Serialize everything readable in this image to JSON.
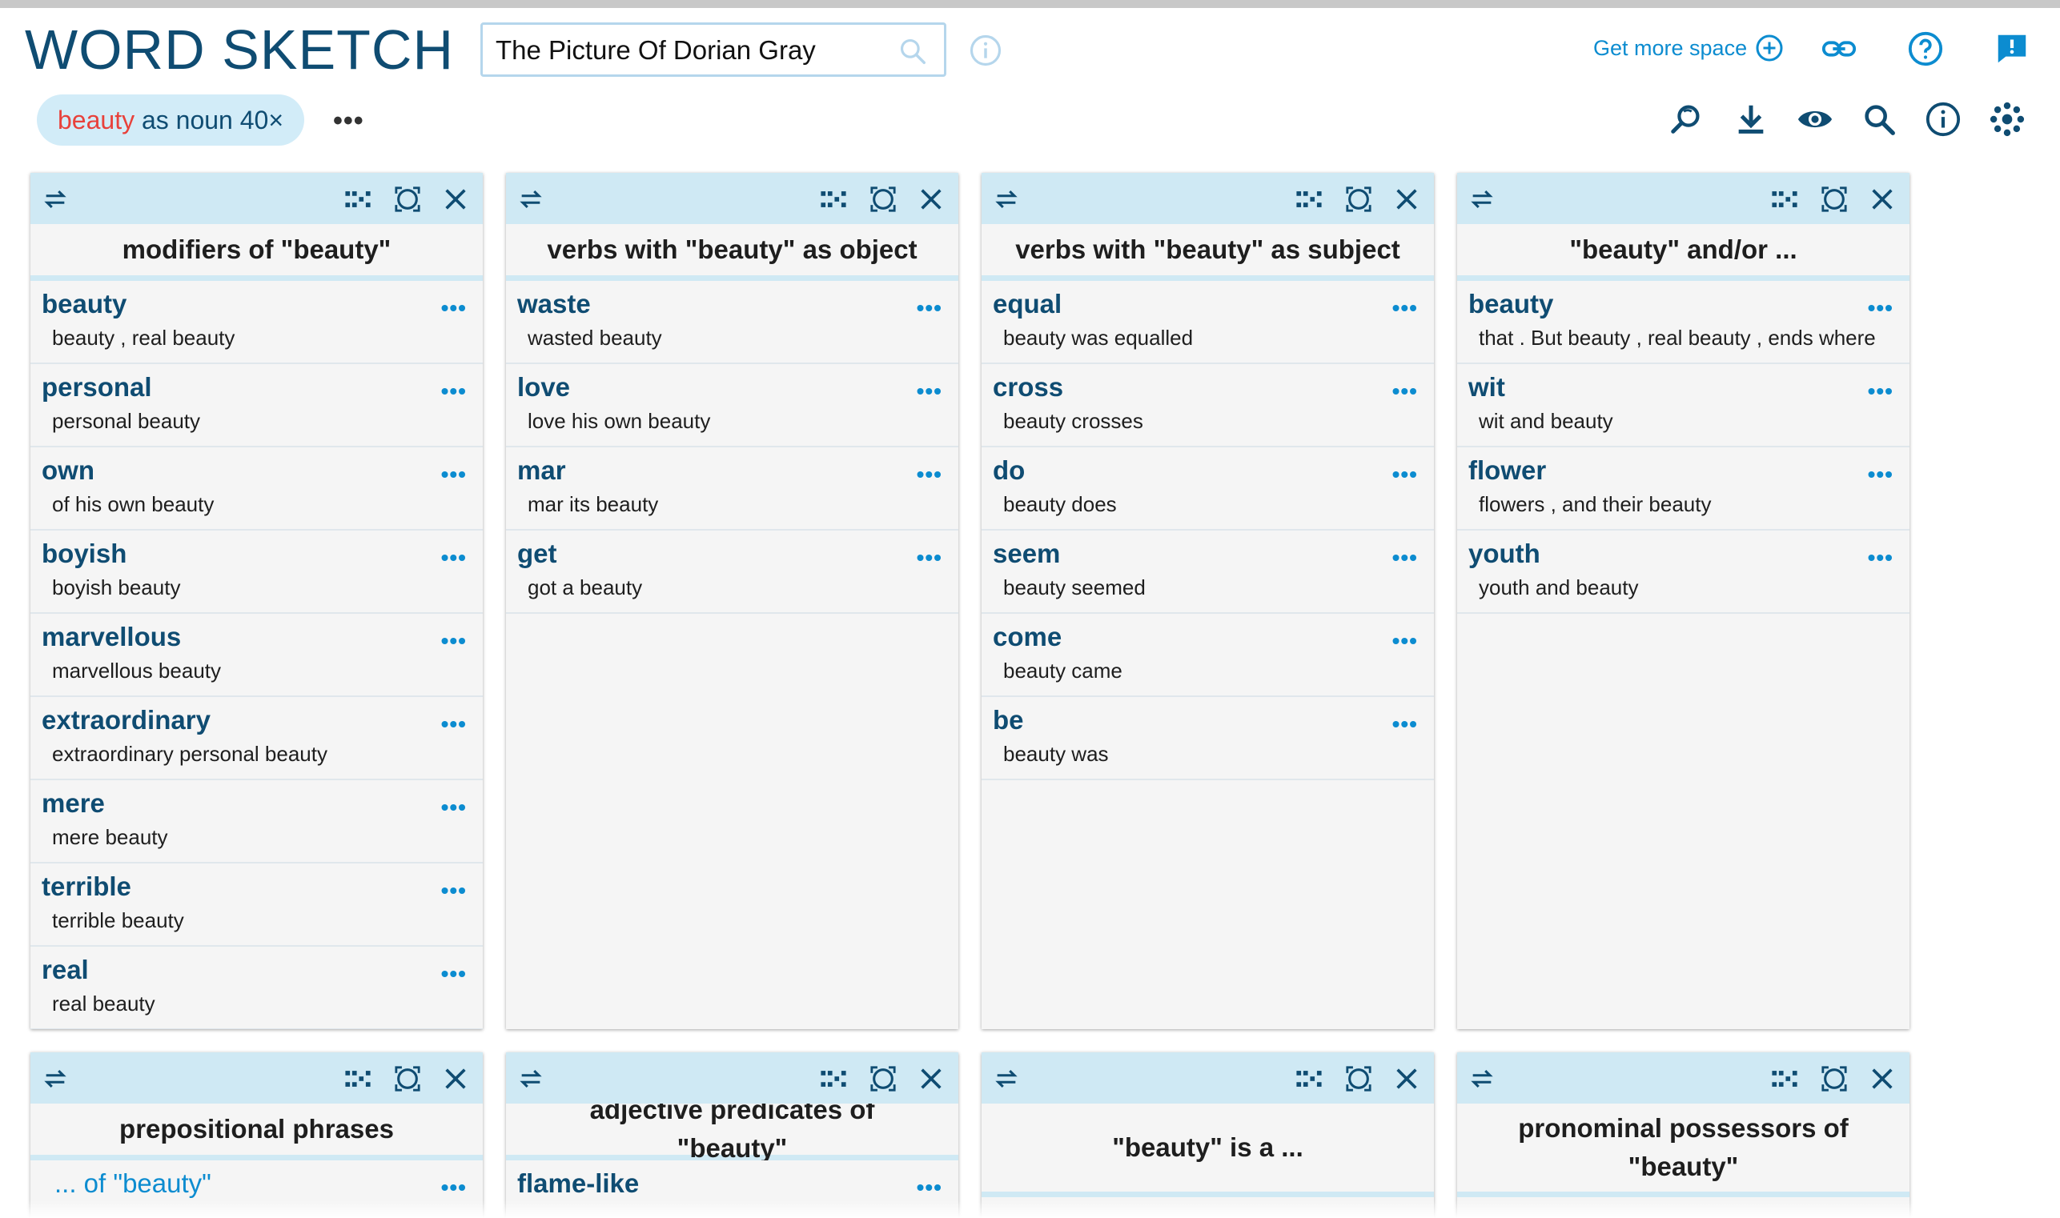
{
  "app": {
    "title": "WORD SKETCH",
    "search_value": "The Picture Of Dorian Gray",
    "get_more_space": "Get more space"
  },
  "query": {
    "word": "beauty",
    "rest": " as noun 40×",
    "more": "•••"
  },
  "colors": {
    "brand": "#0f4c72",
    "accent": "#0c8cd0",
    "highlight": "#e8413b",
    "panel_bar": "#cfe9f4"
  },
  "icons": {
    "top": [
      "info-icon",
      "link-icon",
      "help-icon",
      "feedback-icon"
    ],
    "toolbar": [
      "zoom-search-icon",
      "download-icon",
      "view-icon",
      "search-icon",
      "info-icon",
      "settings-icon"
    ]
  },
  "panels": [
    {
      "title": "modifiers of \"beauty\"",
      "rows": [
        {
          "head": "beauty",
          "ex": "beauty , real beauty"
        },
        {
          "head": "personal",
          "ex": "personal beauty"
        },
        {
          "head": "own",
          "ex": "of his own beauty"
        },
        {
          "head": "boyish",
          "ex": "boyish beauty"
        },
        {
          "head": "marvellous",
          "ex": "marvellous beauty"
        },
        {
          "head": "extraordinary",
          "ex": "extraordinary personal beauty"
        },
        {
          "head": "mere",
          "ex": "mere beauty"
        },
        {
          "head": "terrible",
          "ex": "terrible beauty"
        },
        {
          "head": "real",
          "ex": "real beauty"
        }
      ]
    },
    {
      "title": "verbs with \"beauty\" as object",
      "rows": [
        {
          "head": "waste",
          "ex": "wasted beauty"
        },
        {
          "head": "love",
          "ex": "love his own beauty"
        },
        {
          "head": "mar",
          "ex": "mar its beauty"
        },
        {
          "head": "get",
          "ex": "got a beauty"
        }
      ]
    },
    {
      "title": "verbs with \"beauty\" as subject",
      "rows": [
        {
          "head": "equal",
          "ex": "beauty was equalled"
        },
        {
          "head": "cross",
          "ex": "beauty crosses"
        },
        {
          "head": "do",
          "ex": "beauty does"
        },
        {
          "head": "seem",
          "ex": "beauty seemed"
        },
        {
          "head": "come",
          "ex": "beauty came"
        },
        {
          "head": "be",
          "ex": "beauty was"
        }
      ]
    },
    {
      "title": "\"beauty\" and/or ...",
      "rows": [
        {
          "head": "beauty",
          "ex": "that . But beauty , real beauty , ends where"
        },
        {
          "head": "wit",
          "ex": "wit and beauty"
        },
        {
          "head": "flower",
          "ex": "flowers , and their beauty"
        },
        {
          "head": "youth",
          "ex": "youth and beauty"
        }
      ]
    },
    {
      "title": "prepositional phrases",
      "rows": [
        {
          "head": "... of \"beauty\"",
          "ex": ""
        }
      ]
    },
    {
      "title": "adjective predicates of \"beauty\"",
      "rows": [
        {
          "head": "flame-like",
          "ex": ""
        }
      ]
    },
    {
      "title": "\"beauty\" is a ...",
      "rows": []
    },
    {
      "title": "pronominal possessors of \"beauty\"",
      "rows": []
    }
  ]
}
